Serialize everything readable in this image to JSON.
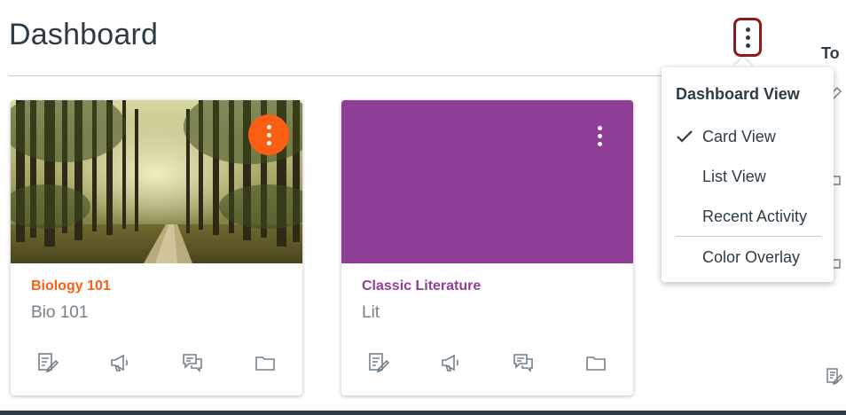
{
  "header": {
    "title": "Dashboard",
    "options_icon": "more-vertical-icon"
  },
  "sidebar": {
    "todo_heading": "To",
    "icons": [
      "pencil-icon",
      "comment-icon",
      "comment-icon",
      "pencil-icon"
    ]
  },
  "cards": [
    {
      "title": "Biology 101",
      "code": "Bio 101",
      "color": "#FC5E13",
      "hero": "forest-path-image",
      "menu_icon": "more-vertical-icon",
      "icons": [
        "assignments-icon",
        "announcements-icon",
        "discussions-icon",
        "files-icon"
      ]
    },
    {
      "title": "Classic Literature",
      "code": "Lit",
      "color": "#8F3E97",
      "hero": "solid-color",
      "menu_icon": "more-vertical-icon",
      "icons": [
        "assignments-icon",
        "announcements-icon",
        "discussions-icon",
        "files-icon"
      ]
    }
  ],
  "dropdown": {
    "heading": "Dashboard View",
    "items": [
      {
        "label": "Card View",
        "checked": true
      },
      {
        "label": "List View",
        "checked": false
      },
      {
        "label": "Recent Activity",
        "checked": false
      },
      {
        "label": "Color Overlay",
        "checked": false
      }
    ]
  },
  "colors": {
    "text": "#2D3B45",
    "muted": "#73818C",
    "focus_ring": "#8B1A1A",
    "divider": "#C7CDD1"
  }
}
